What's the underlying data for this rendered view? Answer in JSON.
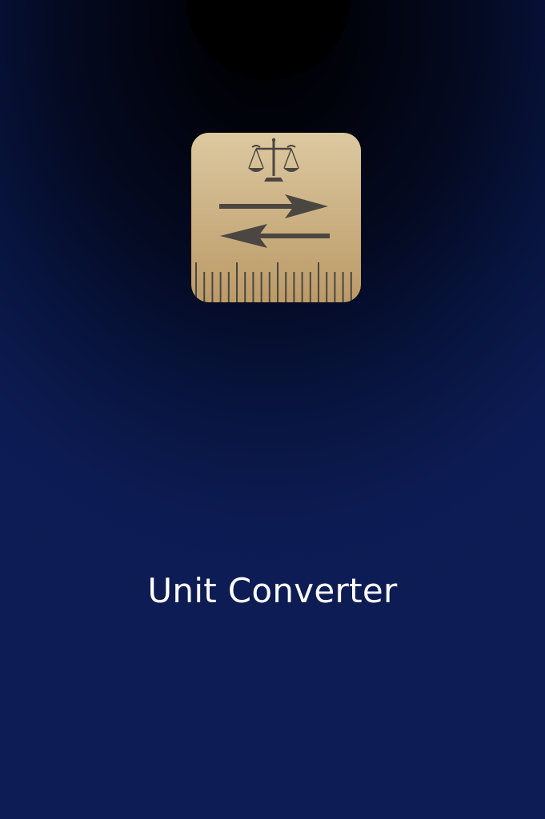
{
  "screen": {
    "background_top": "#000000",
    "background_bottom": "#0e1c55"
  },
  "app_icon": {
    "name": "unit-converter-app-icon",
    "icon_parts": [
      "balance-scale-icon",
      "arrow-right-icon",
      "arrow-left-icon",
      "ruler-ticks"
    ],
    "tile_color": "#cdb386",
    "glyph_color": "#4a4641"
  },
  "splash": {
    "title": "Unit Converter",
    "title_color": "#ffffff"
  }
}
